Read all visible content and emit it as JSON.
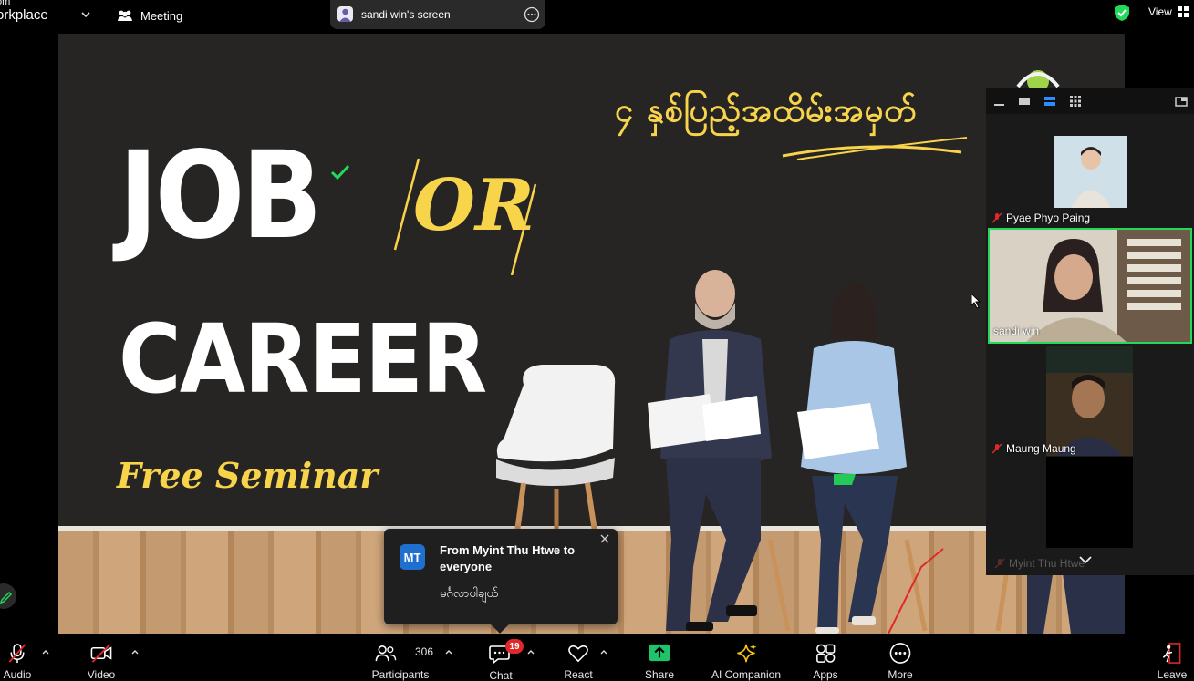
{
  "topbar": {
    "app_title_line1": "om",
    "app_title_line2": "orkplace",
    "meeting_label": "Meeting",
    "share_label": "sandi win's screen",
    "view_label": "View"
  },
  "slide": {
    "myanmar_title": "၄ နှစ်ပြည့်အထိမ်းအမှတ်",
    "job_text": "JOB",
    "or_text": "OR",
    "career_text": "CAREER",
    "seminar_text": "Free Seminar"
  },
  "gallery": {
    "participants": [
      {
        "name": "Pyae Phyo Paing",
        "muted": true
      },
      {
        "name": "sandi win",
        "muted": false,
        "active": true
      },
      {
        "name": "Maung Maung",
        "muted": true
      },
      {
        "name": "Myint Thu Htwe",
        "muted": true
      }
    ]
  },
  "chat_toast": {
    "initials": "MT",
    "from": "From Myint Thu Htwe to everyone",
    "message": "မင်္ဂလာပါချယ်"
  },
  "toolbar": {
    "audio": "Audio",
    "video": "Video",
    "participants": "Participants",
    "participant_count": "306",
    "chat": "Chat",
    "chat_badge": "19",
    "react": "React",
    "share": "Share",
    "ai_companion": "AI Companion",
    "apps": "Apps",
    "more": "More",
    "leave": "Leave"
  },
  "colors": {
    "accent_green": "#23d959",
    "share_green": "#1fc36a",
    "badge_red": "#e02828",
    "slide_yellow": "#f7d44a",
    "slide_bg": "#272424"
  }
}
